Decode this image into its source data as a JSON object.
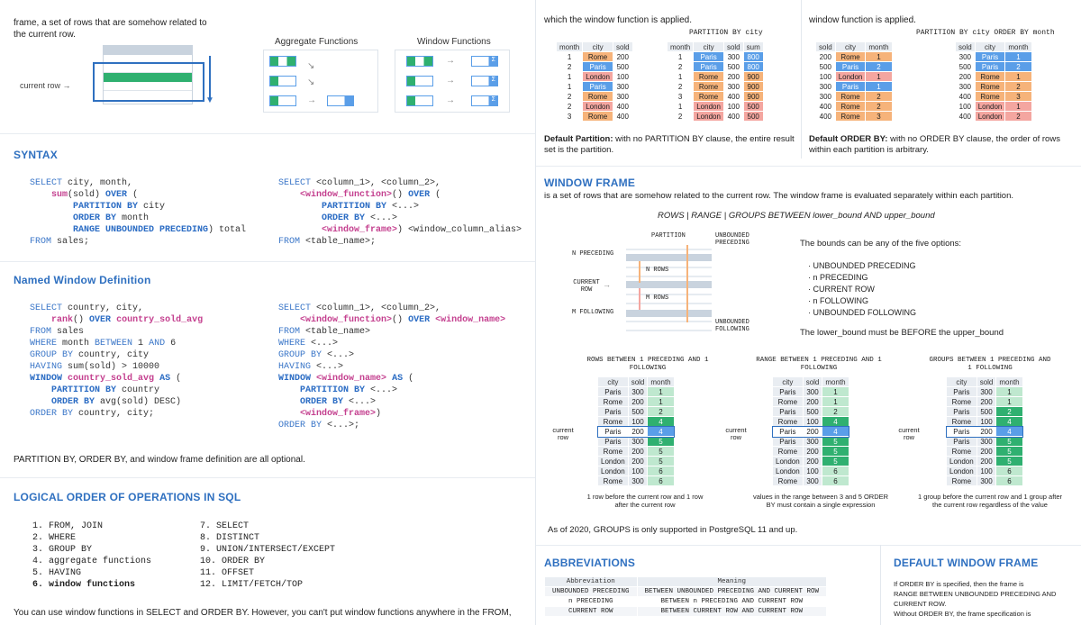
{
  "intro": {
    "line1": "frame, a set of rows that are somehow related to",
    "line2": "the current row."
  },
  "diagram": {
    "current_row_label": "current row",
    "agg_title": "Aggregate Functions",
    "win_title": "Window Functions",
    "sigma": "Σ"
  },
  "syntax": {
    "title": "SYNTAX",
    "left": [
      "SELECT city, month,",
      "    sum(sold) OVER (",
      "        PARTITION BY city",
      "        ORDER BY month",
      "        RANGE UNBOUNDED PRECEDING) total",
      "FROM sales;"
    ],
    "right": [
      "SELECT <column_1>, <column_2>,",
      "    <window_function>() OVER (",
      "        PARTITION BY <...>",
      "        ORDER BY <...>",
      "        <window_frame>) <window_column_alias>",
      "FROM <table_name>;"
    ]
  },
  "named": {
    "title": "Named Window Definition",
    "left": [
      "SELECT country, city,",
      "    rank() OVER country_sold_avg",
      "FROM sales",
      "WHERE month BETWEEN 1 AND 6",
      "GROUP BY country, city",
      "HAVING sum(sold) > 10000",
      "WINDOW country_sold_avg AS (",
      "    PARTITION BY country",
      "    ORDER BY avg(sold) DESC)",
      "ORDER BY country, city;"
    ],
    "right": [
      "SELECT <column_1>, <column_2>,",
      "    <window_function>() OVER <window_name>",
      "FROM <table_name>",
      "WHERE <...>",
      "GROUP BY <...>",
      "HAVING <...>",
      "WINDOW <window_name> AS (",
      "    PARTITION BY <...>",
      "    ORDER BY <...>",
      "    <window_frame>)",
      "ORDER BY <...>;"
    ],
    "optional_note": "PARTITION BY, ORDER BY, and window frame definition are all optional."
  },
  "logical": {
    "title": "LOGICAL ORDER OF OPERATIONS IN SQL",
    "col1": [
      "1.   FROM, JOIN",
      "2.   WHERE",
      "3.   GROUP BY",
      "4.   aggregate functions",
      "5.   HAVING",
      "6.   window functions"
    ],
    "col2": [
      "7.   SELECT",
      "8.   DISTINCT",
      "9.   UNION/INTERSECT/EXCEPT",
      "10.  ORDER BY",
      "11.  OFFSET",
      "12.  LIMIT/FETCH/TOP"
    ],
    "footer": "You can use window functions in SELECT and ORDER BY. However, you can't put window functions anywhere in the FROM,"
  },
  "partition": {
    "desc_left": "which the window function is applied.",
    "desc_right": "window function is applied.",
    "label_mid": "PARTITION BY city",
    "label_right": "PARTITION BY city ORDER BY month",
    "t1_head": [
      "month",
      "city",
      "sold"
    ],
    "t1": [
      [
        "1",
        "Rome",
        "200"
      ],
      [
        "2",
        "Paris",
        "500"
      ],
      [
        "1",
        "London",
        "100"
      ],
      [
        "1",
        "Paris",
        "300"
      ],
      [
        "2",
        "Rome",
        "300"
      ],
      [
        "2",
        "London",
        "400"
      ],
      [
        "3",
        "Rome",
        "400"
      ]
    ],
    "t2_head": [
      "month",
      "city",
      "sold",
      "sum"
    ],
    "t2": [
      [
        "1",
        "Paris",
        "300",
        "800"
      ],
      [
        "2",
        "Paris",
        "500",
        "800"
      ],
      [
        "1",
        "Rome",
        "200",
        "900"
      ],
      [
        "2",
        "Rome",
        "300",
        "900"
      ],
      [
        "3",
        "Rome",
        "400",
        "900"
      ],
      [
        "1",
        "London",
        "100",
        "500"
      ],
      [
        "2",
        "London",
        "400",
        "500"
      ]
    ],
    "t3_head": [
      "sold",
      "city",
      "month"
    ],
    "t3": [
      [
        "200",
        "Rome",
        "1"
      ],
      [
        "500",
        "Paris",
        "2"
      ],
      [
        "100",
        "London",
        "1"
      ],
      [
        "300",
        "Paris",
        "1"
      ],
      [
        "300",
        "Rome",
        "2"
      ],
      [
        "400",
        "Rome",
        "2"
      ],
      [
        "400",
        "Rome",
        "3"
      ]
    ],
    "t4_head": [
      "sold",
      "city",
      "month"
    ],
    "t4": [
      [
        "300",
        "Paris",
        "1"
      ],
      [
        "500",
        "Paris",
        "2"
      ],
      [
        "200",
        "Rome",
        "1"
      ],
      [
        "300",
        "Rome",
        "2"
      ],
      [
        "400",
        "Rome",
        "3"
      ],
      [
        "100",
        "London",
        "1"
      ],
      [
        "400",
        "London",
        "2"
      ]
    ],
    "default_partition_b": "Default Partition:",
    "default_partition": " with no PARTITION BY clause, the entire result set is the partition.",
    "default_order_b": "Default ORDER BY:",
    "default_order": " with no ORDER BY clause, the order of rows within each partition is arbitrary."
  },
  "frame": {
    "title": "WINDOW FRAME",
    "desc": "is a set of rows that are somehow related to the current row. The window frame is evaluated separately within each partition.",
    "formula": "ROWS | RANGE | GROUPS BETWEEN lower_bound AND upper_bound",
    "partition_label": "PARTITION",
    "unbounded_preceding": "UNBOUNDED PRECEDING",
    "unbounded_following": "UNBOUNDED FOLLOWING",
    "n_preceding": "N PRECEDING",
    "current_row": "CURRENT ROW",
    "m_following": "M FOLLOWING",
    "n_rows": "N ROWS",
    "m_rows": "M ROWS",
    "bounds_intro": "The bounds can be any of the five options:",
    "bounds": [
      "· UNBOUNDED PRECEDING",
      "· n PRECEDING",
      "· CURRENT ROW",
      "· n FOLLOWING",
      "· UNBOUNDED FOLLOWING"
    ],
    "bounds_note": "The lower_bound must be BEFORE the upper_bound"
  },
  "examples": {
    "head": [
      "city",
      "sold",
      "month"
    ],
    "rows": [
      [
        "Paris",
        "300",
        "1"
      ],
      [
        "Rome",
        "200",
        "1"
      ],
      [
        "Paris",
        "500",
        "2"
      ],
      [
        "Rome",
        "100",
        "4"
      ],
      [
        "Paris",
        "200",
        "4"
      ],
      [
        "Paris",
        "300",
        "5"
      ],
      [
        "Rome",
        "200",
        "5"
      ],
      [
        "London",
        "200",
        "5"
      ],
      [
        "London",
        "100",
        "6"
      ],
      [
        "Rome",
        "300",
        "6"
      ]
    ],
    "current_label": "current row",
    "ex1_title": "ROWS BETWEEN 1 PRECEDING AND 1 FOLLOWING",
    "ex1_note": "1 row before the current row and 1 row after the current row",
    "ex2_title": "RANGE BETWEEN 1 PRECEDING AND 1 FOLLOWING",
    "ex2_note": "values in the range between 3 and 5 ORDER BY must contain a single expression",
    "ex3_title": "GROUPS BETWEEN 1 PRECEDING AND 1 FOLLOWING",
    "ex3_note": "1 group before the current row and 1 group after the current row regardless of the value",
    "groups_note": "As of 2020, GROUPS is only supported in PostgreSQL 11 and up."
  },
  "abbrev": {
    "title": "ABBREVIATIONS",
    "head": [
      "Abbreviation",
      "Meaning"
    ],
    "rows": [
      [
        "UNBOUNDED PRECEDING",
        "BETWEEN UNBOUNDED PRECEDING AND CURRENT ROW"
      ],
      [
        "n PRECEDING",
        "BETWEEN n PRECEDING AND CURRENT ROW"
      ],
      [
        "CURRENT ROW",
        "BETWEEN CURRENT ROW AND CURRENT ROW"
      ]
    ]
  },
  "default_frame": {
    "title": "DEFAULT WINDOW FRAME",
    "text": [
      "If ORDER BY is specified, then the frame is",
      "RANGE BETWEEN UNBOUNDED PRECEDING AND",
      "CURRENT ROW.",
      "Without ORDER BY, the frame specification is"
    ]
  },
  "colors": {
    "blue": "#2f70c0",
    "orange": "#f6b37a",
    "green": "#2fb070",
    "pink": "#c4408f"
  }
}
